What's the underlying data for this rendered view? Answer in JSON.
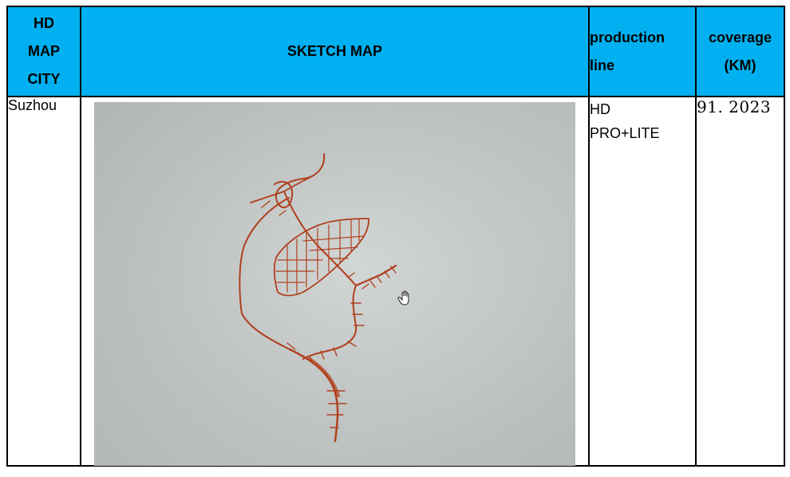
{
  "table": {
    "headers": {
      "city": [
        "HD",
        "MAP",
        "CITY"
      ],
      "sketch": "SKETCH MAP",
      "production_line": [
        "production",
        "line"
      ],
      "coverage": [
        "coverage",
        "(KM)"
      ]
    },
    "rows": [
      {
        "city": "Suzhou",
        "production_line": [
          "HD",
          "PRO+LITE"
        ],
        "coverage": "91. 2023"
      }
    ]
  },
  "sketch": {
    "ink_color": "#b0401f",
    "paper_color": "#c6cbca",
    "cursor_icon": "hand-cursor-icon"
  }
}
